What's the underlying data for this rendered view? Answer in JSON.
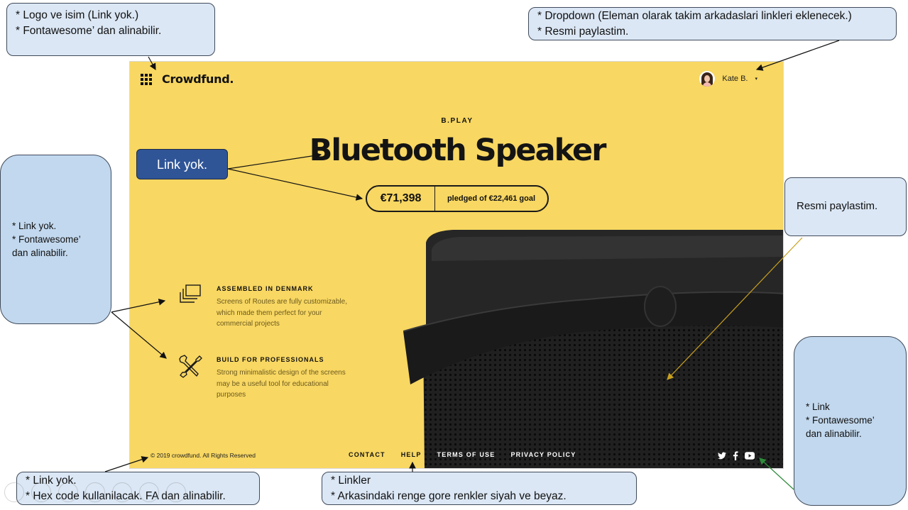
{
  "mockup": {
    "logo": {
      "icon": "grid-icon",
      "text": "Crowdfund."
    },
    "user": {
      "name": "Kate B.",
      "caret": "▾"
    },
    "brand": "B.PLAY",
    "title": "Bluetooth Speaker",
    "pledge": {
      "amount": "€71,398",
      "goal_text": "pledged of €22,461 goal"
    },
    "features": [
      {
        "icon": "stacked-squares-icon",
        "title": "ASSEMBLED IN DENMARK",
        "text": "Screens of Routes are fully customizable, which made them perfect for your commercial projects"
      },
      {
        "icon": "wrench-screwdriver-icon",
        "title": "BUILD FOR PROFESSIONALS",
        "text": "Strong minimalistic design of the screens may be a useful tool for educational purposes"
      }
    ],
    "footer": {
      "copyright": "© 2019 crowdfund. All Rights Reserved",
      "links": [
        "CONTACT",
        "HELP",
        "TERMS OF USE",
        "PRIVACY POLICY"
      ],
      "social": [
        "twitter-icon",
        "facebook-icon",
        "youtube-icon"
      ]
    },
    "colors": {
      "background": "#f8d762",
      "text": "#111111",
      "speaker": "#1c1c1c",
      "feature_text": "#6b5a20"
    }
  },
  "annotations": {
    "logo_note": [
      "* Logo ve isim (Link yok.)",
      "* Fontawesome’ dan alinabilir."
    ],
    "dropdown_note": [
      "* Dropdown (Eleman olarak takim arkadaslari linkleri eklenecek.)",
      "* Resmi paylastim."
    ],
    "title_note": "Link yok.",
    "image_note": "Resmi paylastim.",
    "features_note": [
      "* Link yok.",
      "* Fontawesome’",
      "dan alinabilir."
    ],
    "social_note": [
      "* Link",
      "* Fontawesome’",
      "dan alinabilir."
    ],
    "copyright_note": [
      "* Link yok.",
      "* Hex code kullanilacak. FA dan alinabilir."
    ],
    "footer_note": [
      "* Linkler",
      "* Arkasindaki renge gore renkler siyah ve beyaz."
    ],
    "colors": {
      "note_light": "#dbe7f5",
      "note_blue": "#c2d8ee",
      "note_dark": "#2f5597"
    }
  }
}
